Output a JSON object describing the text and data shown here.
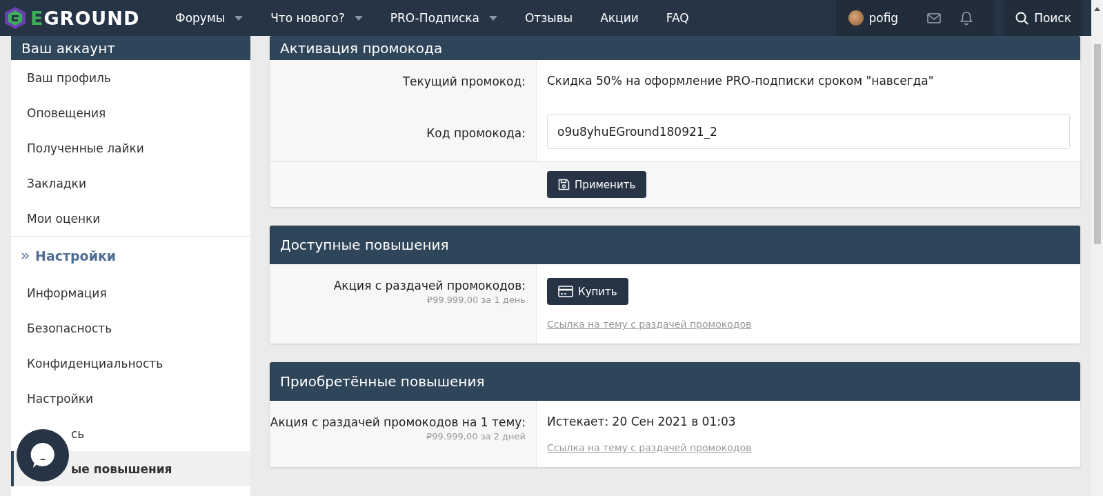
{
  "header": {
    "logo": "EGROUND",
    "nav": [
      {
        "label": "Форумы",
        "dropdown": true
      },
      {
        "label": "Что нового?",
        "dropdown": true
      },
      {
        "label": "PRO-Подписка",
        "dropdown": true
      },
      {
        "label": "Отзывы",
        "dropdown": false
      },
      {
        "label": "Акции",
        "dropdown": false
      },
      {
        "label": "FAQ",
        "dropdown": false
      }
    ],
    "user": "pofig",
    "search": "Поиск"
  },
  "sidebar": {
    "title": "Ваш аккаунт",
    "items": [
      {
        "label": "Ваш профиль",
        "selected": false
      },
      {
        "label": "Оповещения",
        "selected": false
      },
      {
        "label": "Полученные лайки",
        "selected": false
      },
      {
        "label": "Закладки",
        "selected": false
      },
      {
        "label": "Мои оценки",
        "selected": false
      }
    ],
    "section": "Настройки",
    "section_items": [
      {
        "label": "Информация",
        "selected": false
      },
      {
        "label": "Безопасность",
        "selected": false
      },
      {
        "label": "Конфиденциальность",
        "selected": false
      },
      {
        "label": "Настройки",
        "selected": false
      },
      {
        "label": "сь",
        "selected": false
      },
      {
        "label": "ые повышения",
        "selected": true
      }
    ]
  },
  "panels": [
    {
      "title": "Активация промокода",
      "rows": [
        {
          "kind": "text",
          "label": "Текущий промокод:",
          "value": "Скидка 50% на оформление PRO-подписки сроком \"навсегда\""
        },
        {
          "kind": "input",
          "label": "Код промокода:",
          "value": "o9u8yhuEGround180921_2"
        }
      ],
      "footer_button": "Применить"
    },
    {
      "title": "Доступные повышения",
      "rows": [
        {
          "kind": "buy",
          "label": "Акция с раздачей промокодов:",
          "hint": "₽99.999,00 за 1 день",
          "button": "Купить",
          "link": "Ссылка на тему с раздачей промокодов"
        }
      ]
    },
    {
      "title": "Приобретённые повышения",
      "rows": [
        {
          "kind": "text",
          "label": "Акция с раздачей промокодов на 1 тему:",
          "hint": "₽99.999,00 за 2 дней",
          "value": "Истекает: 20 Сен 2021 в 01:03",
          "link": "Ссылка на тему с раздачей промокодов"
        }
      ]
    }
  ]
}
